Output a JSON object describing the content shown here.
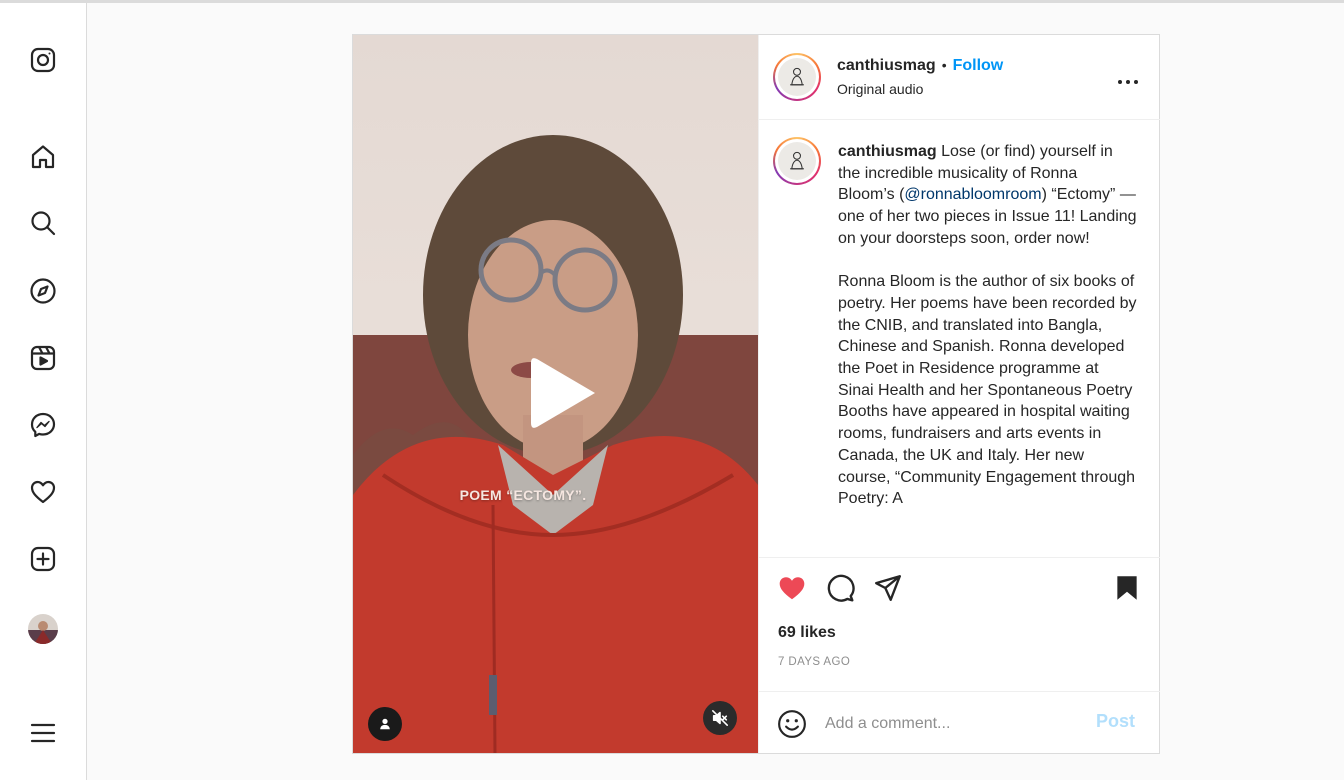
{
  "app": {
    "accent": "#0095f6",
    "like_color": "#ed4956"
  },
  "sidebar": {
    "items": [
      {
        "name": "instagram",
        "icon": "instagram-logo-icon"
      },
      {
        "name": "home",
        "icon": "home-icon"
      },
      {
        "name": "search",
        "icon": "search-icon"
      },
      {
        "name": "explore",
        "icon": "compass-icon"
      },
      {
        "name": "reels",
        "icon": "reels-icon"
      },
      {
        "name": "messages",
        "icon": "messenger-icon"
      },
      {
        "name": "notifications",
        "icon": "heart-icon"
      },
      {
        "name": "create",
        "icon": "plus-square-icon"
      },
      {
        "name": "profile",
        "icon": "avatar"
      },
      {
        "name": "more",
        "icon": "menu-icon"
      }
    ]
  },
  "video": {
    "overlay_caption": "POEM “ECTOMY”.",
    "play_icon": "play-icon",
    "muted": true
  },
  "post": {
    "username": "canthiusmag",
    "follow_label": "Follow",
    "separator": "•",
    "audio_label": "Original audio",
    "caption_username": "canthiusmag",
    "caption_part1": " Lose (or find) yourself in the incredible musicality of Ronna Bloom’s (",
    "mention": "@ronnabloomroom",
    "caption_part2": ") “Ectomy” — one of her two pieces in Issue 11! Landing on your doorsteps soon, order now!",
    "caption_paragraph2": "Ronna Bloom is the author of six books of poetry. Her poems have been recorded by the CNIB, and translated into Bangla, Chinese and Spanish. Ronna developed the Poet in Residence programme at Sinai Health and her Spontaneous Poetry Booths have appeared in hospital waiting rooms, fundraisers and arts events in Canada, the UK and Italy. Her new course, “Community Engagement through Poetry: A",
    "likes": "69 likes",
    "date": "7 DAYS AGO",
    "liked": true,
    "saved": true
  },
  "comment": {
    "placeholder": "Add a comment...",
    "post_label": "Post"
  }
}
